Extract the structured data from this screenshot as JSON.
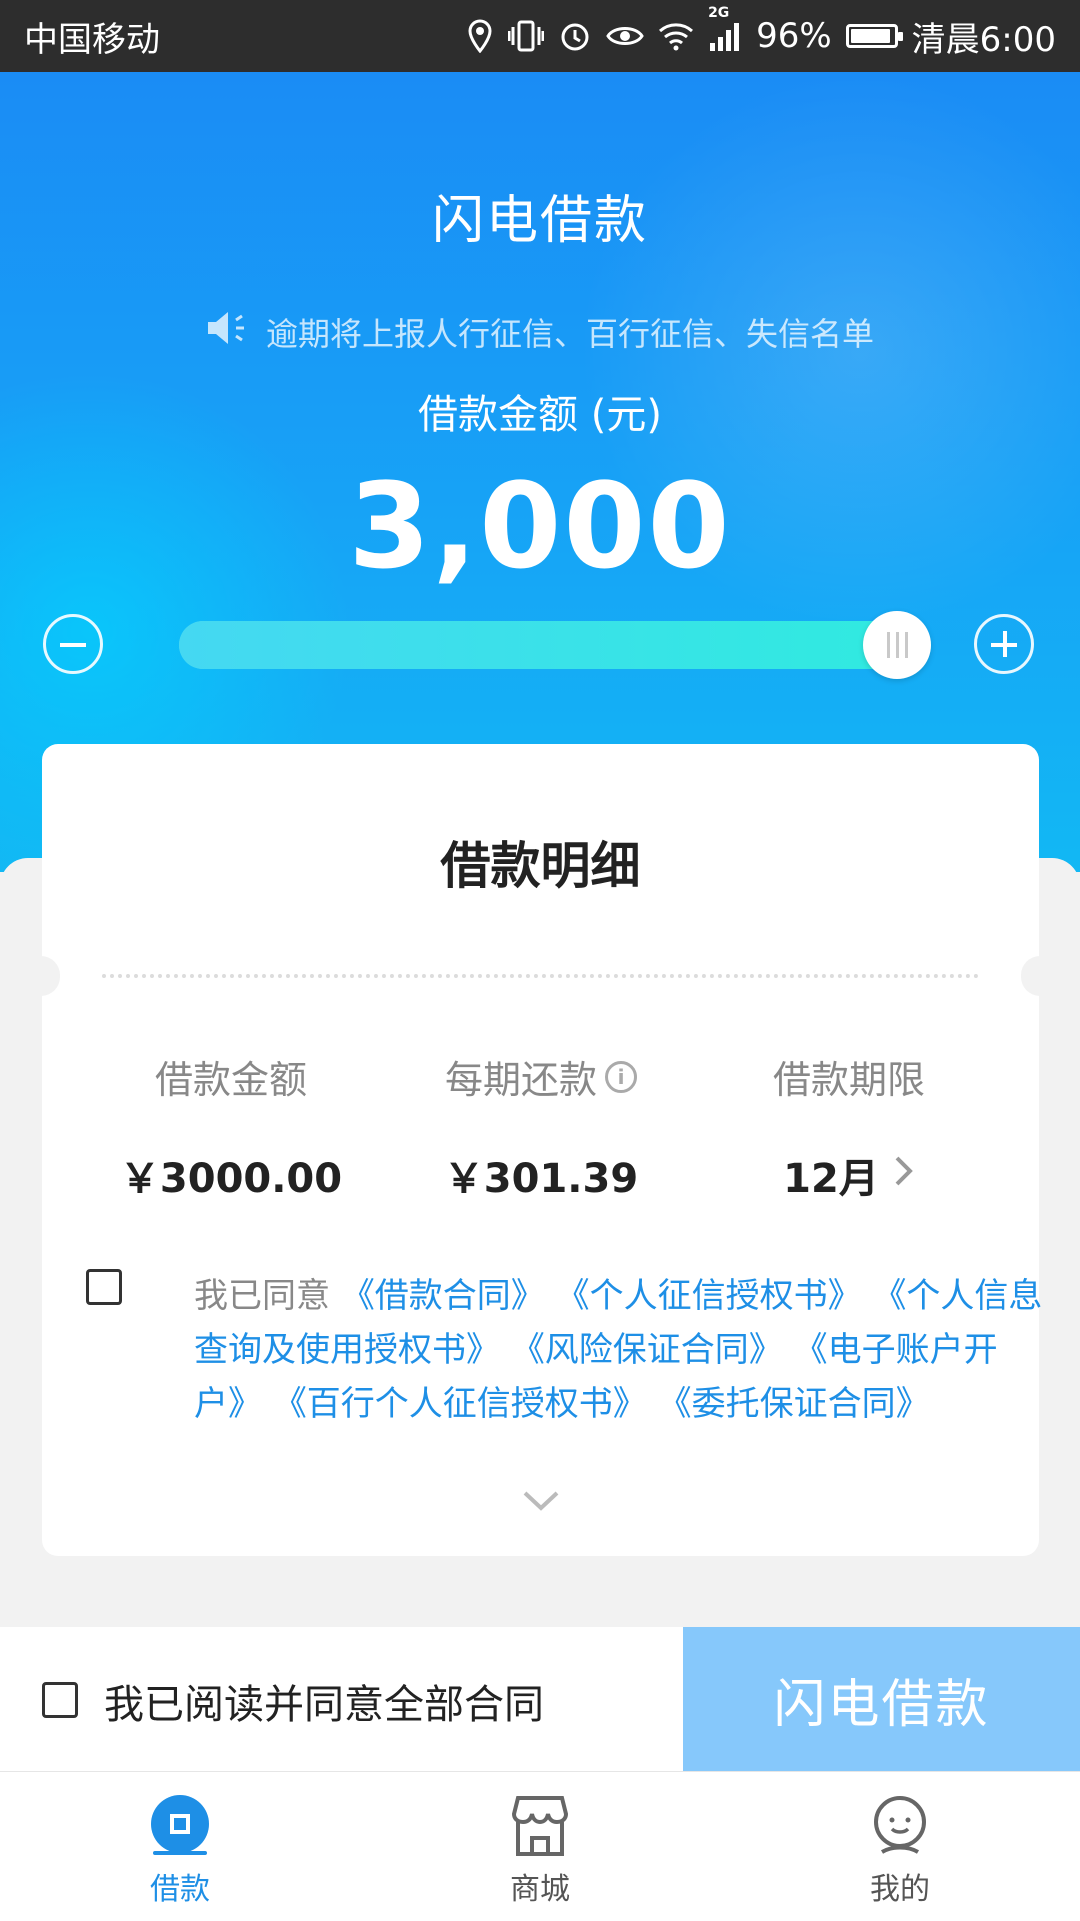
{
  "status_bar": {
    "carrier": "中国移动",
    "network_badge": "2G",
    "battery": "96%",
    "time": "清晨6:00",
    "icons": [
      "location-icon",
      "vibrate-icon",
      "alarm-icon",
      "eye-icon",
      "wifi-icon",
      "signal-icon",
      "battery-icon"
    ]
  },
  "header": {
    "title": "闪电借款",
    "notice": "逾期将上报人行征信、百行征信、失信名单"
  },
  "loan": {
    "amount_label": "借款金额 (元)",
    "amount_value": "3,000",
    "slider_fraction": 1.0
  },
  "detail_card": {
    "title": "借款明细",
    "columns": [
      {
        "label": "借款金额",
        "value": "￥3000.00"
      },
      {
        "label": "每期还款",
        "value": "￥301.39"
      },
      {
        "label": "借款期限",
        "value": "12月"
      }
    ],
    "agree_prefix": "我已同意",
    "contracts": [
      "《借款合同》",
      "《个人征信授权书》",
      "《个人信息查询及使用授权书》",
      "《风险保证合同》",
      "《电子账户开户》",
      "《百行个人征信授权书》",
      "《委托保证合同》"
    ]
  },
  "bottom": {
    "read_all": "我已阅读并同意全部合同",
    "borrow_button": "闪电借款"
  },
  "tabs": [
    {
      "label": "借款",
      "icon": "loan-icon",
      "active": true
    },
    {
      "label": "商城",
      "icon": "shop-icon",
      "active": false
    },
    {
      "label": "我的",
      "icon": "profile-icon",
      "active": false
    }
  ],
  "colors": {
    "accent": "#1e8fe6",
    "hero_top": "#1a8cf5",
    "button_disabled": "#86c8fb",
    "slider": "#30eae0"
  }
}
